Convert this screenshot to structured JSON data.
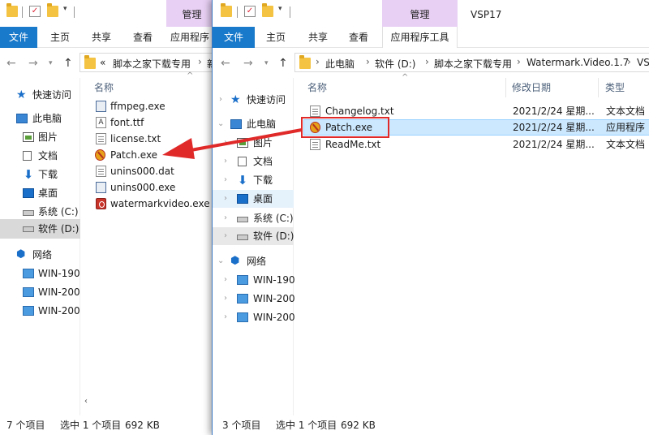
{
  "back_window": {
    "context_tab": "管理",
    "ribbon_tabs": [
      "文件",
      "主页",
      "共享",
      "查看",
      "应用程序"
    ],
    "address_prefix": "«",
    "address_crumbs": [
      "脚本之家下载专用",
      "新"
    ],
    "nav_items": [
      {
        "label": "快速访问",
        "icon": "star-icon"
      },
      {
        "label": "此电脑",
        "icon": "computer-icon"
      },
      {
        "label": "图片",
        "icon": "pictures-icon"
      },
      {
        "label": "文档",
        "icon": "documents-icon"
      },
      {
        "label": "下载",
        "icon": "downloads-icon"
      },
      {
        "label": "桌面",
        "icon": "desktop-icon"
      },
      {
        "label": "系统 (C:)",
        "icon": "drive-icon"
      },
      {
        "label": "软件 (D:)",
        "icon": "drive-icon",
        "selected": true
      },
      {
        "label": "网络",
        "icon": "network-icon"
      },
      {
        "label": "WIN-190",
        "icon": "monitor-icon"
      },
      {
        "label": "WIN-200",
        "icon": "monitor-icon"
      },
      {
        "label": "WIN-200",
        "icon": "monitor-icon"
      }
    ],
    "column_header": "名称",
    "files": [
      {
        "name": "ffmpeg.exe",
        "icon": "exe-icon"
      },
      {
        "name": "font.ttf",
        "icon": "font-icon"
      },
      {
        "name": "license.txt",
        "icon": "text-file-icon"
      },
      {
        "name": "Patch.exe",
        "icon": "patch-icon"
      },
      {
        "name": "unins000.dat",
        "icon": "text-file-icon"
      },
      {
        "name": "unins000.exe",
        "icon": "exe-icon"
      },
      {
        "name": "watermarkvideo.exe",
        "icon": "watermark-icon"
      }
    ],
    "status": {
      "count": "7 个项目",
      "selection": "选中 1 个项目",
      "size": "692 KB"
    }
  },
  "front_window": {
    "context_tab": "管理",
    "title": "VSP17",
    "ribbon_tabs": [
      "文件",
      "主页",
      "共享",
      "查看",
      "应用程序工具"
    ],
    "address_crumbs": [
      "此电脑",
      "软件 (D:)",
      "脚本之家下载专用",
      "Watermark.Video.1.7",
      "VS"
    ],
    "nav_items": [
      {
        "label": "快速访问",
        "icon": "star-icon"
      },
      {
        "label": "此电脑",
        "icon": "computer-icon"
      },
      {
        "label": "图片",
        "icon": "pictures-icon"
      },
      {
        "label": "文档",
        "icon": "documents-icon"
      },
      {
        "label": "下载",
        "icon": "downloads-icon"
      },
      {
        "label": "桌面",
        "icon": "desktop-icon"
      },
      {
        "label": "系统 (C:)",
        "icon": "drive-icon"
      },
      {
        "label": "软件 (D:)",
        "icon": "drive-icon"
      },
      {
        "label": "网络",
        "icon": "network-icon"
      },
      {
        "label": "WIN-190",
        "icon": "monitor-icon"
      },
      {
        "label": "WIN-200",
        "icon": "monitor-icon"
      },
      {
        "label": "WIN-200",
        "icon": "monitor-icon"
      }
    ],
    "columns": [
      "名称",
      "修改日期",
      "类型"
    ],
    "files": [
      {
        "name": "Changelog.txt",
        "date": "2021/2/24 星期...",
        "type": "文本文档",
        "icon": "text-file-icon"
      },
      {
        "name": "Patch.exe",
        "date": "2021/2/24 星期...",
        "type": "应用程序",
        "icon": "patch-icon",
        "selected": true
      },
      {
        "name": "ReadMe.txt",
        "date": "2021/2/24 星期...",
        "type": "文本文档",
        "icon": "text-file-icon"
      }
    ],
    "status": {
      "count": "3 个项目",
      "selection": "选中 1 个项目",
      "size": "692 KB"
    }
  },
  "colors": {
    "accent": "#1979ca",
    "context_tab": "#e8d0f4",
    "highlight": "#e02a2a",
    "selection": "#cce8ff"
  }
}
